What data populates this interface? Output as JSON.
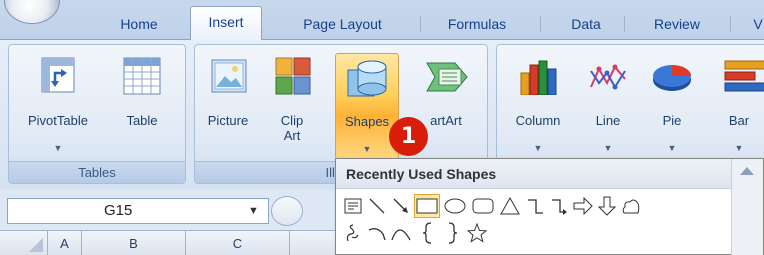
{
  "tabs": [
    {
      "label": "Home",
      "active": false
    },
    {
      "label": "Insert",
      "active": true
    },
    {
      "label": "Page Layout",
      "active": false
    },
    {
      "label": "Formulas",
      "active": false
    },
    {
      "label": "Data",
      "active": false
    },
    {
      "label": "Review",
      "active": false
    },
    {
      "label": "V",
      "active": false
    }
  ],
  "groups": {
    "tables": {
      "label": "Tables",
      "buttons": [
        {
          "label": "PivotTable",
          "icon": "pivot-table-icon"
        },
        {
          "label": "Table",
          "icon": "table-icon"
        }
      ]
    },
    "illustrations": {
      "label": "Illustr",
      "buttons": [
        {
          "label": "Picture",
          "icon": "picture-icon"
        },
        {
          "label": "Clip Art",
          "icon": "clip-art-icon"
        },
        {
          "label": "Shapes",
          "icon": "shapes-icon"
        },
        {
          "label": "artArt",
          "icon": "smartart-icon"
        }
      ]
    },
    "charts": {
      "buttons": [
        {
          "label": "Column",
          "icon": "column-chart-icon"
        },
        {
          "label": "Line",
          "icon": "line-chart-icon"
        },
        {
          "label": "Pie",
          "icon": "pie-chart-icon"
        },
        {
          "label": "Bar",
          "icon": "bar-chart-icon"
        }
      ]
    }
  },
  "badge": "1",
  "formula_bar": {
    "name_box": "G15"
  },
  "columns": [
    "A",
    "B",
    "C"
  ],
  "shapes_dropdown": {
    "header": "Recently Used Shapes",
    "row1": [
      "text-box-icon",
      "line-icon",
      "arrow-line-icon",
      "rectangle-icon",
      "oval-icon",
      "rounded-rectangle-icon",
      "triangle-icon",
      "elbow-connector-icon",
      "elbow-arrow-connector-icon",
      "right-arrow-icon",
      "down-arrow-icon",
      "cloud-shape-icon"
    ],
    "row2": [
      "freeform-scribble-icon",
      "arc-icon",
      "curve-icon",
      "left-brace-icon",
      "right-brace-icon",
      "star-icon"
    ]
  },
  "colors": {
    "highlight": "#ffcf5a",
    "badge": "#d81d0a"
  }
}
